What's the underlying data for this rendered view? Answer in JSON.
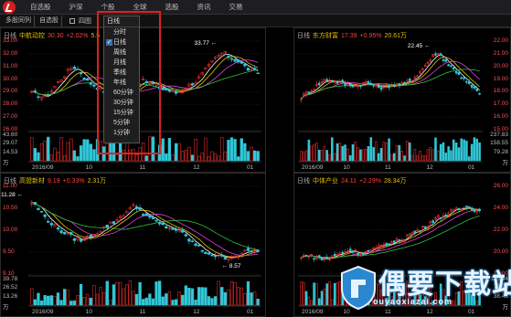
{
  "nav": {
    "items": [
      "自选股",
      "沪深",
      "个股",
      "全球",
      "选股",
      "资讯",
      "交易"
    ]
  },
  "toolbar": {
    "btn1": "多股同列",
    "btn2": "自选股",
    "square_label": "四图"
  },
  "dropdown": {
    "header": "日线",
    "items": [
      "分时",
      "日线",
      "周线",
      "月线",
      "季线",
      "年线",
      "60分钟",
      "30分钟",
      "15分钟",
      "5分钟",
      "1分钟"
    ],
    "selected_index": 1
  },
  "panels": [
    {
      "period": "日线",
      "name": "中航动控",
      "price": "30.30",
      "change": "+2.02%",
      "extra": "5.5",
      "yticks": [
        "33.00",
        "32.00",
        "31.00",
        "30.00",
        "29.00",
        "28.00",
        "27.00",
        "26.00"
      ],
      "vol_ticks": [
        "43.60",
        "29.07",
        "14.53",
        "万"
      ],
      "xticks": [
        "2016/09",
        "10",
        "11",
        "12",
        "01"
      ],
      "high_label": "33.77",
      "low_label": "26.10"
    },
    {
      "period": "日线",
      "name": "东方财富",
      "price": "17.39",
      "change": "+0.95%",
      "extra": "20.61万",
      "yticks": [
        "22.00",
        "21.00",
        "20.00",
        "19.00",
        "18.00",
        "17.00",
        "16.00",
        "15.00"
      ],
      "vol_ticks": [
        "237.83",
        "158.55",
        "79.28",
        "万"
      ],
      "xticks": [
        "2016/09",
        "10",
        "11",
        "12",
        "01"
      ],
      "high_label": "22.45"
    },
    {
      "period": "日线",
      "name": "高盟新材",
      "price": "9.19",
      "change": "+0.33%",
      "extra": "2.31万",
      "yticks": [
        "11.00",
        "10.50",
        "10.00",
        "9.50",
        "9.10"
      ],
      "vol_ticks": [
        "39.78",
        "26.52",
        "13.26",
        "万"
      ],
      "xticks": [
        "2016/09",
        "10",
        "11",
        "12",
        "01"
      ],
      "high_label": "11.28",
      "low_label": "8.57"
    },
    {
      "period": "日线",
      "name": "中体产业",
      "price": "24.11",
      "change": "+2.29%",
      "extra": "28.34万",
      "yticks": [
        "26.00",
        "24.00",
        "22.00",
        "20.00",
        "18.00"
      ],
      "vol_ticks": [
        "115.44",
        "76.96",
        "38.48",
        "万"
      ],
      "xticks": [
        "2016/09",
        "10",
        "11",
        "12",
        "01"
      ]
    }
  ],
  "watermark": {
    "text": "偶要下载站",
    "url": "ouyaoxiazai.com"
  },
  "colors": {
    "up": "#ff3030",
    "down": "#30c8d8",
    "ma5": "#ffffff",
    "ma10": "#e0c000",
    "ma20": "#e040e0",
    "ma60": "#30c040",
    "highlight": "#e02020"
  }
}
